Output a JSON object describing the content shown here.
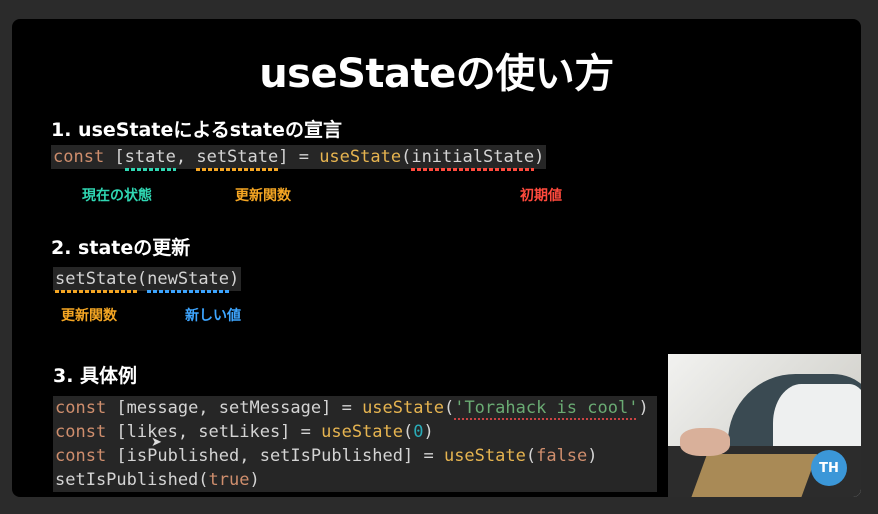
{
  "title": "useStateの使い方",
  "section1": {
    "heading": "1. useStateによるstateの宣言",
    "code": {
      "kw": "const",
      "open": " [",
      "state": "state",
      "comma": ", ",
      "setState": "setState",
      "close": "] = ",
      "fn": "useState",
      "paren_open": "(",
      "arg": "initialState",
      "paren_close": ")"
    },
    "labels": {
      "current_state": "現在の状態",
      "updater": "更新関数",
      "initial": "初期値"
    }
  },
  "section2": {
    "heading": "2. stateの更新",
    "code": {
      "fn": "setState",
      "paren_open": "(",
      "arg": "newState",
      "paren_close": ")"
    },
    "labels": {
      "updater": "更新関数",
      "new_value": "新しい値"
    }
  },
  "section3": {
    "heading": "3. 具体例",
    "lines": [
      {
        "kw": "const",
        "mid": " [message, setMessage] = ",
        "fn": "useState",
        "po": "(",
        "arg": "'Torahack is cool'",
        "pc": ")"
      },
      {
        "kw": "const",
        "mid": " [likes, setLikes] = ",
        "fn": "useState",
        "po": "(",
        "arg": "0",
        "pc": ")"
      },
      {
        "kw": "const",
        "mid": " [isPublished, setIsPublished] = ",
        "fn": "useState",
        "po": "(",
        "arg": "false",
        "pc": ")"
      },
      {
        "kw": "",
        "mid": "setIsPublished(",
        "fn": "",
        "po": "",
        "arg": "true",
        "pc": ")"
      }
    ]
  },
  "webcam": {
    "mascot_text": "TH"
  },
  "colors": {
    "teal": "#2fd6b2",
    "orange": "#f5a623",
    "red": "#ff4a3d",
    "blue": "#3da5ff",
    "keyword": "#cf8e6d",
    "function": "#e6b450"
  },
  "icons": {
    "cursor": "mouse-pointer-icon"
  }
}
